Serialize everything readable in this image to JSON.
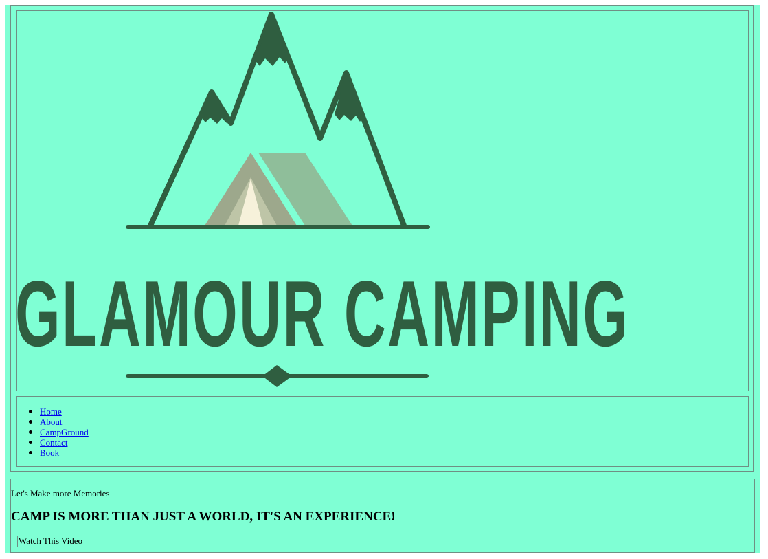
{
  "brand": {
    "title": "GLAMOUR CAMPING",
    "colors": {
      "background": "#7fffd4",
      "logo_dark": "#2f5e40",
      "tent_left": "#9da88c",
      "tent_right": "#8fbe9a",
      "tent_door": "#f6f1da",
      "border": "#6f8f84"
    }
  },
  "nav": {
    "items": [
      {
        "label": "Home"
      },
      {
        "label": "About"
      },
      {
        "label": "CampGround"
      },
      {
        "label": "Contact"
      },
      {
        "label": "Book"
      }
    ]
  },
  "hero": {
    "tagline": "Let's Make more Memories",
    "headline": "CAMP IS MORE THAN JUST A WORLD, IT'S AN EXPERIENCE!",
    "video_button": "Watch This Video"
  }
}
